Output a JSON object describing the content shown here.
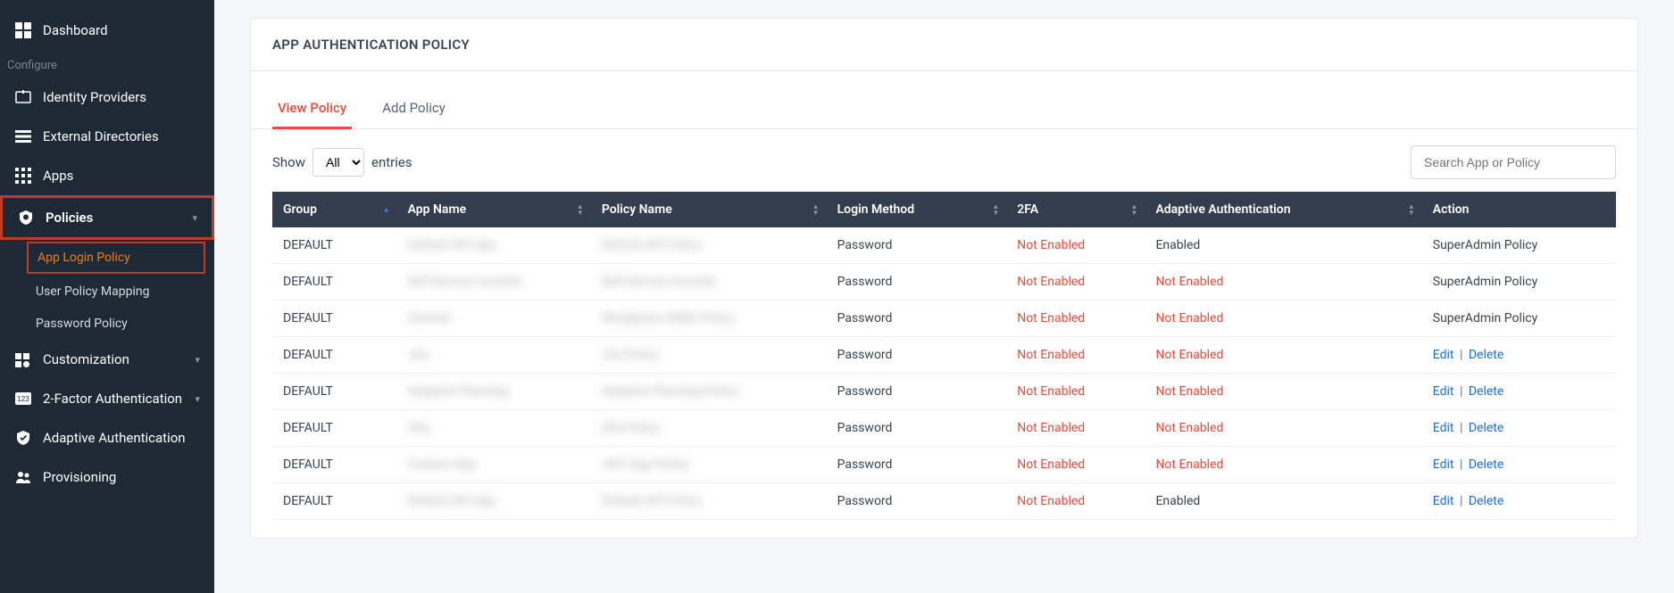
{
  "sidebar": {
    "dashboard": "Dashboard",
    "section_configure": "Configure",
    "identity_providers": "Identity Providers",
    "external_directories": "External Directories",
    "apps": "Apps",
    "policies": "Policies",
    "policies_sub": {
      "app_login": "App Login Policy",
      "user_policy_mapping": "User Policy Mapping",
      "password_policy": "Password Policy"
    },
    "customization": "Customization",
    "two_factor": "2-Factor Authentication",
    "adaptive_auth": "Adaptive Authentication",
    "provisioning": "Provisioning"
  },
  "page": {
    "title": "APP AUTHENTICATION POLICY",
    "tabs": {
      "view": "View Policy",
      "add": "Add Policy"
    },
    "show_label": "Show",
    "entries_label": "entries",
    "entries_value": "All",
    "search_placeholder": "Search App or Policy"
  },
  "table": {
    "headers": {
      "group": "Group",
      "app_name": "App Name",
      "policy_name": "Policy Name",
      "login_method": "Login Method",
      "twofa": "2FA",
      "adaptive": "Adaptive Authentication",
      "action": "Action"
    },
    "labels": {
      "not_enabled": "Not Enabled",
      "enabled": "Enabled",
      "edit": "Edit",
      "delete": "Delete",
      "superadmin_policy": "SuperAdmin Policy"
    },
    "rows": [
      {
        "group": "DEFAULT",
        "app_name": "Default API App",
        "policy_name": "Default API Policy",
        "login_method": "Password",
        "twofa": "Not Enabled",
        "adaptive": "Enabled",
        "action_type": "text"
      },
      {
        "group": "DEFAULT",
        "app_name": "Self Service Console",
        "policy_name": "Self Service Console",
        "login_method": "Password",
        "twofa": "Not Enabled",
        "adaptive": "Not Enabled",
        "action_type": "text"
      },
      {
        "group": "DEFAULT",
        "app_name": "Intranet",
        "policy_name": "Wordpress SAML Policy",
        "login_method": "Password",
        "twofa": "Not Enabled",
        "adaptive": "Not Enabled",
        "action_type": "text"
      },
      {
        "group": "DEFAULT",
        "app_name": "Jira",
        "policy_name": "Jira Policy",
        "login_method": "Password",
        "twofa": "Not Enabled",
        "adaptive": "Not Enabled",
        "action_type": "links"
      },
      {
        "group": "DEFAULT",
        "app_name": "Adaptive Planning",
        "policy_name": "Adaptive Planning Policy",
        "login_method": "Password",
        "twofa": "Not Enabled",
        "adaptive": "Not Enabled",
        "action_type": "links"
      },
      {
        "group": "DEFAULT",
        "app_name": "Aha",
        "policy_name": "Aha Policy",
        "login_method": "Password",
        "twofa": "Not Enabled",
        "adaptive": "Not Enabled",
        "action_type": "links"
      },
      {
        "group": "DEFAULT",
        "app_name": "Custom App",
        "policy_name": "JWT App Policy",
        "login_method": "Password",
        "twofa": "Not Enabled",
        "adaptive": "Not Enabled",
        "action_type": "links"
      },
      {
        "group": "DEFAULT",
        "app_name": "Default API App",
        "policy_name": "Default API Policy",
        "login_method": "Password",
        "twofa": "Not Enabled",
        "adaptive": "Enabled",
        "action_type": "links"
      }
    ]
  }
}
